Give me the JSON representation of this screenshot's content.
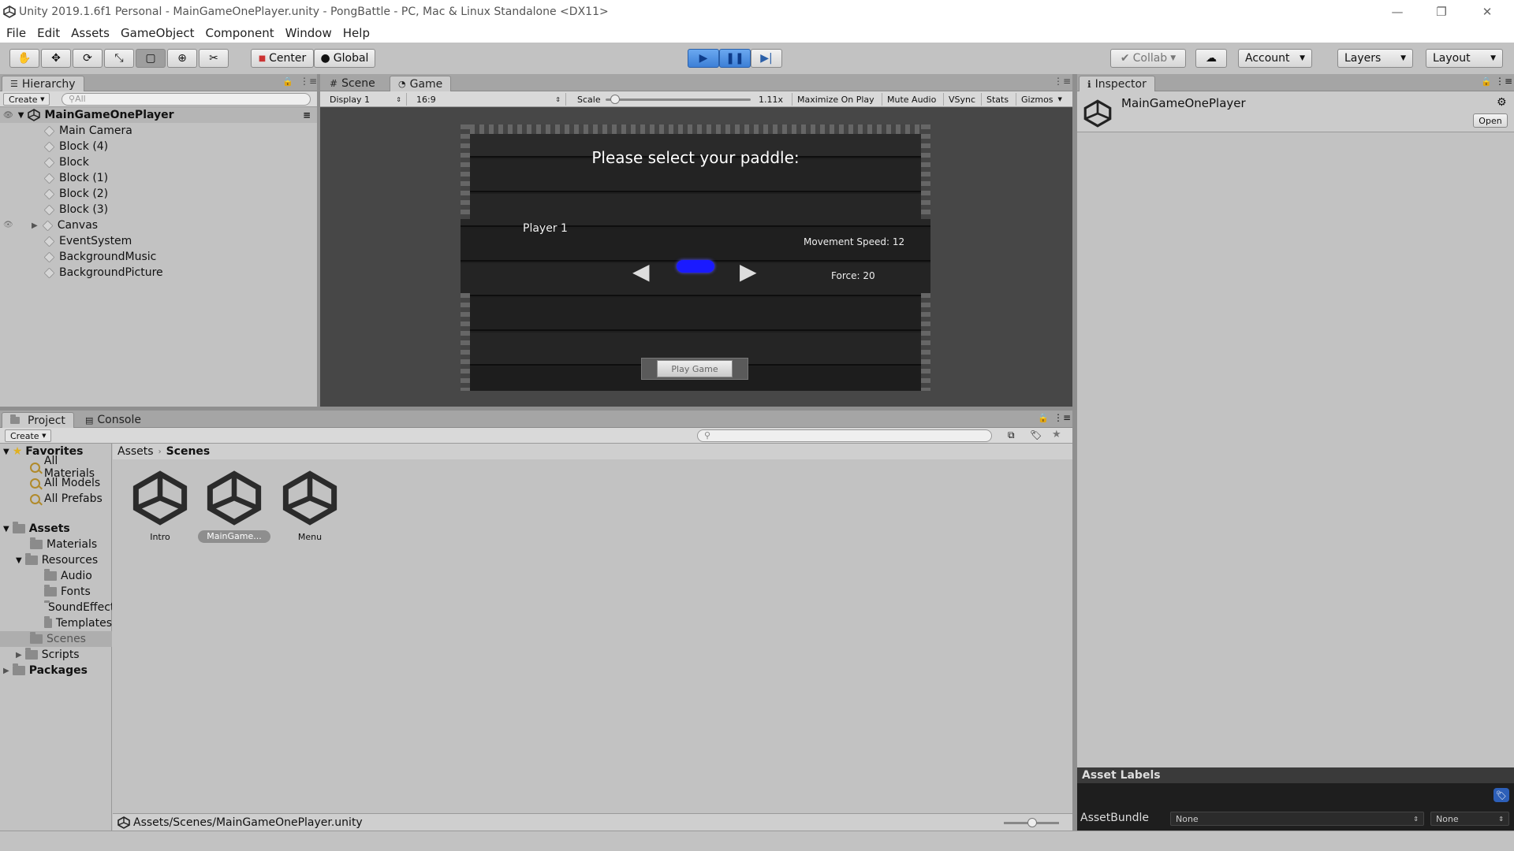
{
  "window": {
    "title": "Unity 2019.1.6f1 Personal - MainGameOnePlayer.unity - PongBattle - PC, Mac & Linux Standalone <DX11>"
  },
  "menu": [
    "File",
    "Edit",
    "Assets",
    "GameObject",
    "Component",
    "Window",
    "Help"
  ],
  "toolbar": {
    "center": "Center",
    "global": "Global",
    "collab": "Collab",
    "account": "Account",
    "layers": "Layers",
    "layout": "Layout"
  },
  "hierarchy": {
    "tab": "Hierarchy",
    "create": "Create",
    "search_placeholder": "All",
    "scene": "MainGameOnePlayer",
    "items": [
      "Main Camera",
      "Block (4)",
      "Block",
      "Block (1)",
      "Block (2)",
      "Block (3)",
      "Canvas",
      "EventSystem",
      "BackgroundMusic",
      "BackgroundPicture"
    ]
  },
  "view_tabs": {
    "scene": "Scene",
    "game": "Game"
  },
  "game_toolbar": {
    "display": "Display 1",
    "aspect": "16:9",
    "scale_label": "Scale",
    "scale_value": "1.11x",
    "maximize": "Maximize On Play",
    "mute": "Mute Audio",
    "vsync": "VSync",
    "stats": "Stats",
    "gizmos": "Gizmos"
  },
  "game": {
    "heading": "Please select your paddle:",
    "player": "Player 1",
    "speed": "Movement Speed: 12",
    "force": "Force: 20",
    "play_button": "Play Game",
    "paddle_color": "#1a1aff"
  },
  "inspector": {
    "tab": "Inspector",
    "object": "MainGameOnePlayer",
    "open": "Open",
    "asset_labels": "Asset Labels",
    "assetbundle": "AssetBundle",
    "bundle_value": "None",
    "variant_value": "None"
  },
  "project": {
    "tab_project": "Project",
    "tab_console": "Console",
    "create": "Create",
    "favorites": "Favorites",
    "fav_items": [
      "All Materials",
      "All Models",
      "All Prefabs"
    ],
    "assets": "Assets",
    "folders": [
      "Materials",
      "Resources",
      "Audio",
      "Fonts",
      "SoundEffects",
      "Templates",
      "Scenes",
      "Scripts"
    ],
    "packages": "Packages",
    "breadcrumb": [
      "Assets",
      "Scenes"
    ],
    "files": [
      "Intro",
      "MainGame...",
      "Menu"
    ],
    "path": "Assets/Scenes/MainGameOnePlayer.unity"
  },
  "colors": {
    "play_active": "#4a8ee6",
    "selection": "#aeaeae"
  }
}
